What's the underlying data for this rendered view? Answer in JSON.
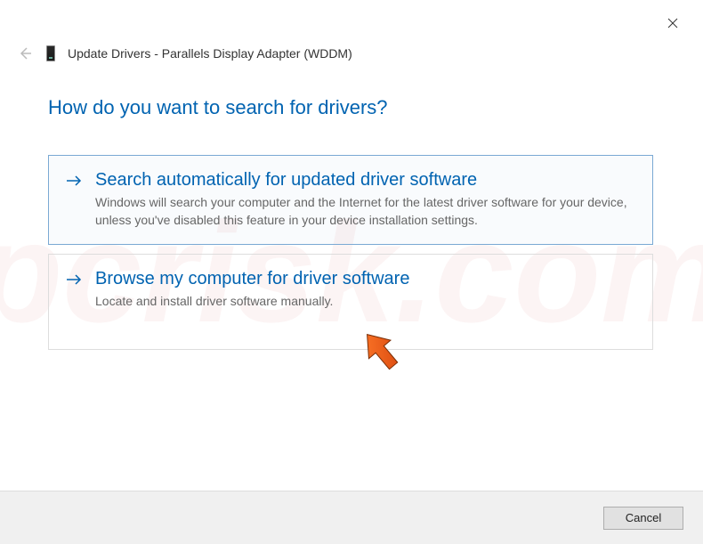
{
  "window": {
    "title": "Update Drivers - Parallels Display Adapter (WDDM)"
  },
  "heading": "How do you want to search for drivers?",
  "options": [
    {
      "title": "Search automatically for updated driver software",
      "desc": "Windows will search your computer and the Internet for the latest driver software for your device, unless you've disabled this feature in your device installation settings."
    },
    {
      "title": "Browse my computer for driver software",
      "desc": "Locate and install driver software manually."
    }
  ],
  "footer": {
    "cancel_label": "Cancel"
  },
  "icons": {
    "close": "close-icon",
    "back": "back-arrow-icon",
    "device": "device-icon",
    "option_arrow": "arrow-right-icon",
    "annotation": "pointer-arrow-annotation"
  },
  "colors": {
    "accent": "#0063B1",
    "text": "#333333",
    "muted": "#666666",
    "border": "#dddddd",
    "annotation": "#e55a1b"
  }
}
